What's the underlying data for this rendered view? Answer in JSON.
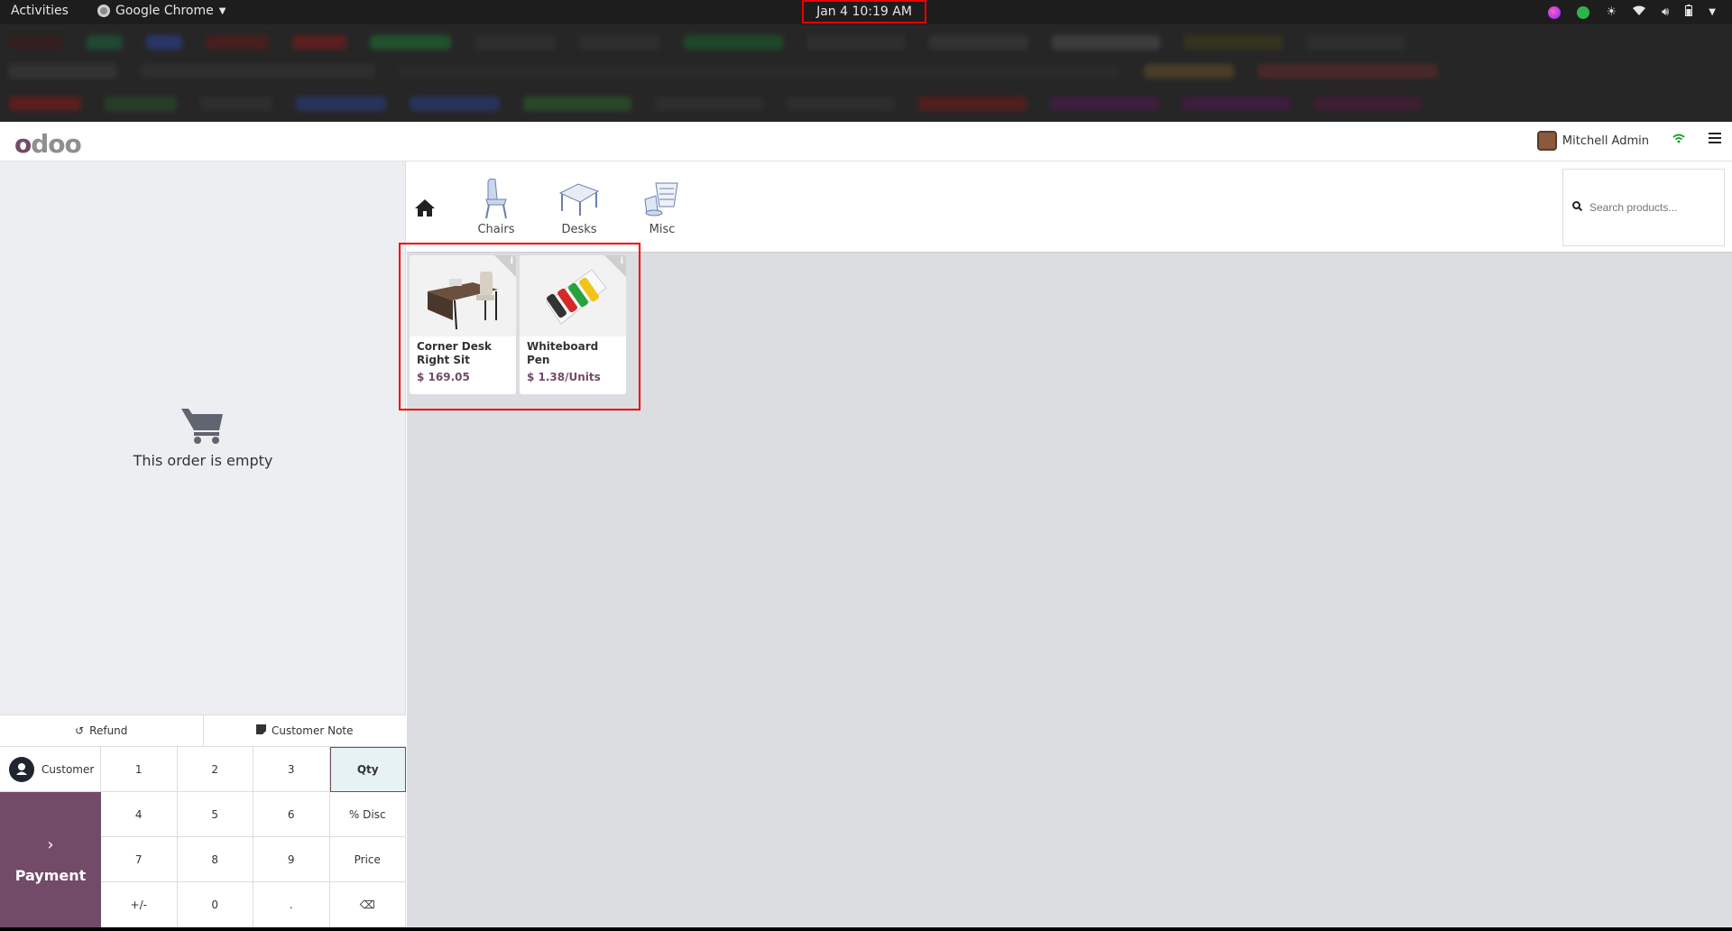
{
  "topbar": {
    "activities": "Activities",
    "app_name": "Google Chrome",
    "clock": "Jan 4  10:19 AM"
  },
  "pos_header": {
    "logo": "odoo",
    "user_name": "Mitchell Admin"
  },
  "order": {
    "empty_text": "This order is empty"
  },
  "actions": {
    "refund": "Refund",
    "customer_note": "Customer Note"
  },
  "numpad": {
    "customer": "Customer",
    "payment": "Payment",
    "keys": [
      "1",
      "2",
      "3",
      "Qty",
      "4",
      "5",
      "6",
      "% Disc",
      "7",
      "8",
      "9",
      "Price",
      "+/-",
      "0",
      ".",
      "⌫"
    ]
  },
  "categories": [
    {
      "label": "Chairs"
    },
    {
      "label": "Desks"
    },
    {
      "label": "Misc"
    }
  ],
  "search": {
    "placeholder": "Search products..."
  },
  "products": [
    {
      "name": "Corner Desk Right Sit",
      "price": "$ 169.05"
    },
    {
      "name": "Whiteboard Pen",
      "price": "$ 1.38/Units"
    }
  ],
  "colors": {
    "brand": "#714b67",
    "highlight_box": "#ee0000"
  }
}
